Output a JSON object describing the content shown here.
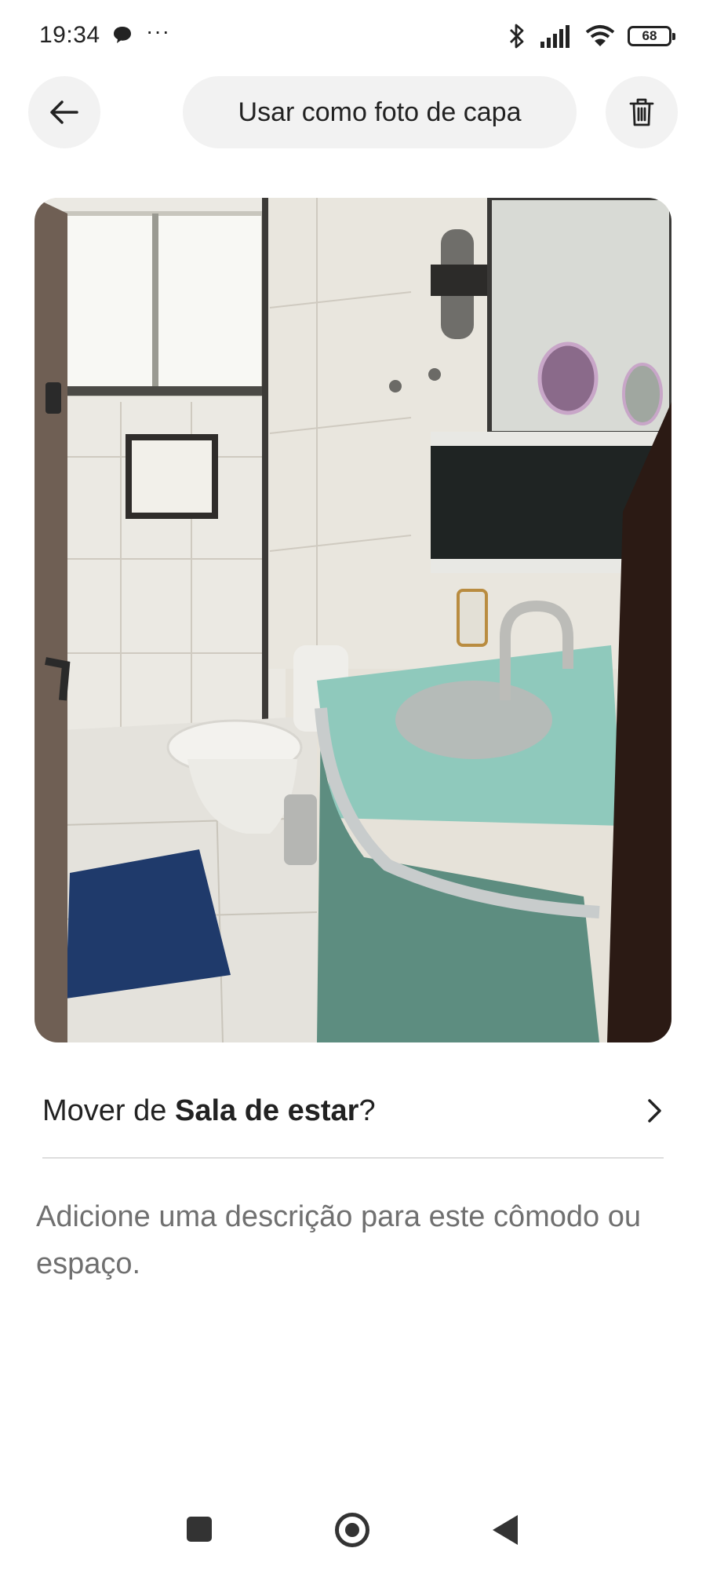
{
  "status_bar": {
    "time": "19:34",
    "more": "···",
    "battery": "68",
    "icons": [
      "chat-bubble-icon",
      "bluetooth-icon",
      "signal-icon",
      "wifi-icon",
      "battery-icon"
    ]
  },
  "header": {
    "back_icon": "arrow-left-icon",
    "cover_label": "Usar como foto de capa",
    "delete_icon": "trash-icon"
  },
  "photo": {
    "subject": "bathroom-photo"
  },
  "move_row": {
    "prefix": "Mover de ",
    "room": "Sala de estar",
    "suffix": "?",
    "chevron_icon": "chevron-right-icon"
  },
  "description": {
    "placeholder": "Adicione uma descrição para este cômodo ou espaço."
  },
  "nav_bar": {
    "icons": [
      "recents-square-icon",
      "home-circle-icon",
      "back-triangle-icon"
    ]
  },
  "colors": {
    "background": "#ffffff",
    "button_bg": "#f2f2f2",
    "text_primary": "#222222",
    "text_secondary": "#707070",
    "divider": "#dddddd"
  }
}
